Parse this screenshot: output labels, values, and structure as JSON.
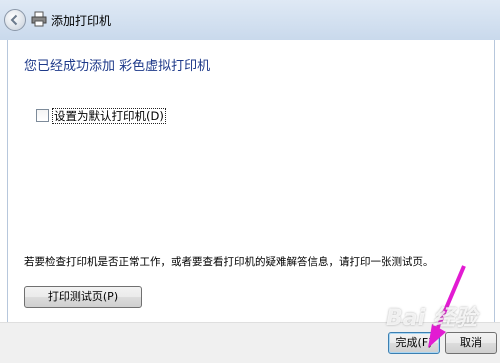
{
  "window": {
    "title": "添加打印机"
  },
  "content": {
    "heading": "您已经成功添加 彩色虚拟打印机",
    "default_printer_checkbox": {
      "label": "设置为默认打印机(D)",
      "checked": false
    },
    "info_text": "若要检查打印机是否正常工作，或者要查看打印机的疑难解答信息，请打印一张测试页。",
    "test_page_button": "打印测试页(P)"
  },
  "footer": {
    "finish_button": "完成(F)",
    "cancel_button": "取消"
  },
  "overlay": {
    "watermark": "Bai 经验"
  }
}
